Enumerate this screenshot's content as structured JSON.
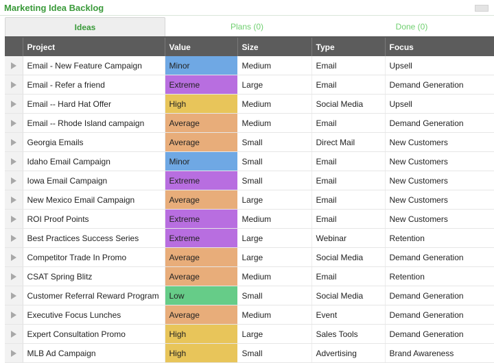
{
  "title": "Marketing Idea Backlog",
  "tabs": [
    {
      "label": "Ideas"
    },
    {
      "label": "Plans (0)"
    },
    {
      "label": "Done (0)"
    }
  ],
  "columns": [
    "Project",
    "Value",
    "Size",
    "Type",
    "Focus"
  ],
  "value_colors": {
    "Minor": "#6fa8e4",
    "Extreme": "#b86ee0",
    "High": "#e8c55a",
    "Average": "#e8ad7a",
    "Low": "#66cc88"
  },
  "rows": [
    {
      "project": "Email - New Feature Campaign",
      "value": "Minor",
      "size": "Medium",
      "type": "Email",
      "focus": "Upsell"
    },
    {
      "project": "Email - Refer a friend",
      "value": "Extreme",
      "size": "Large",
      "type": "Email",
      "focus": "Demand Generation"
    },
    {
      "project": "Email -- Hard Hat Offer",
      "value": "High",
      "size": "Medium",
      "type": "Social Media",
      "focus": "Upsell"
    },
    {
      "project": "Email -- Rhode Island campaign",
      "value": "Average",
      "size": "Medium",
      "type": "Email",
      "focus": "Demand Generation"
    },
    {
      "project": "Georgia Emails",
      "value": "Average",
      "size": "Small",
      "type": "Direct Mail",
      "focus": "New Customers"
    },
    {
      "project": "Idaho Email Campaign",
      "value": "Minor",
      "size": "Small",
      "type": "Email",
      "focus": "New Customers"
    },
    {
      "project": "Iowa Email Campaign",
      "value": "Extreme",
      "size": "Small",
      "type": "Email",
      "focus": "New Customers"
    },
    {
      "project": "New Mexico Email Campaign",
      "value": "Average",
      "size": "Large",
      "type": "Email",
      "focus": "New Customers"
    },
    {
      "project": "ROI Proof Points",
      "value": "Extreme",
      "size": "Medium",
      "type": "Email",
      "focus": "New Customers"
    },
    {
      "project": "Best Practices Success Series",
      "value": "Extreme",
      "size": "Large",
      "type": "Webinar",
      "focus": "Retention"
    },
    {
      "project": "Competitor Trade In Promo",
      "value": "Average",
      "size": "Large",
      "type": "Social Media",
      "focus": "Demand Generation"
    },
    {
      "project": "CSAT Spring Blitz",
      "value": "Average",
      "size": "Medium",
      "type": "Email",
      "focus": "Retention"
    },
    {
      "project": "Customer Referral Reward Program",
      "value": "Low",
      "size": "Small",
      "type": "Social Media",
      "focus": "Demand Generation"
    },
    {
      "project": "Executive Focus Lunches",
      "value": "Average",
      "size": "Medium",
      "type": "Event",
      "focus": "Demand Generation"
    },
    {
      "project": "Expert Consultation Promo",
      "value": "High",
      "size": "Large",
      "type": "Sales Tools",
      "focus": "Demand Generation"
    },
    {
      "project": "MLB Ad Campaign",
      "value": "High",
      "size": "Small",
      "type": "Advertising",
      "focus": "Brand Awareness"
    }
  ]
}
